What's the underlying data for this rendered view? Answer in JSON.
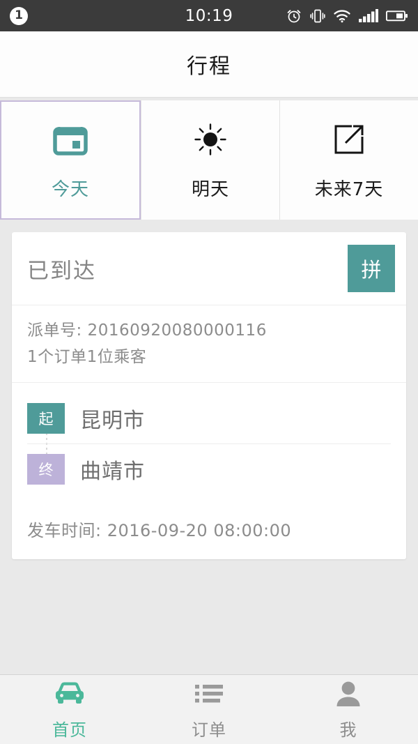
{
  "statusbar": {
    "notification_count": "1",
    "time": "10:19",
    "icons": [
      "alarm-clock-icon",
      "vibrate-icon",
      "wifi-icon",
      "signal-icon",
      "battery-icon"
    ]
  },
  "header": {
    "title": "行程"
  },
  "tabs": [
    {
      "label": "今天",
      "icon": "calendar-icon",
      "active": true,
      "color": "#4f9b99"
    },
    {
      "label": "明天",
      "icon": "sun-icon",
      "active": false,
      "color": "#1b1b1b"
    },
    {
      "label": "未来7天",
      "icon": "external-link-icon",
      "active": false,
      "color": "#1b1b1b"
    }
  ],
  "trip_card": {
    "status": "已到达",
    "carpool_badge": "拼",
    "dispatch_line": "派单号: 20160920080000116",
    "passenger_line": "1个订单1位乘客",
    "route": {
      "start": {
        "badge": "起",
        "city": "昆明市",
        "color": "#4f9b99"
      },
      "end": {
        "badge": "终",
        "city": "曲靖市",
        "color": "#bdb2d9"
      }
    },
    "departure_line": "发车时间: 2016-09-20 08:00:00"
  },
  "bottom_nav": [
    {
      "label": "首页",
      "icon": "car-icon",
      "active": true
    },
    {
      "label": "订单",
      "icon": "list-icon",
      "active": false
    },
    {
      "label": "我",
      "icon": "person-icon",
      "active": false
    }
  ],
  "colors": {
    "accent_teal": "#4f9b99",
    "accent_purple": "#bdb2d9",
    "nav_active": "#4bb89a",
    "page_bg": "#e9e9e9"
  }
}
